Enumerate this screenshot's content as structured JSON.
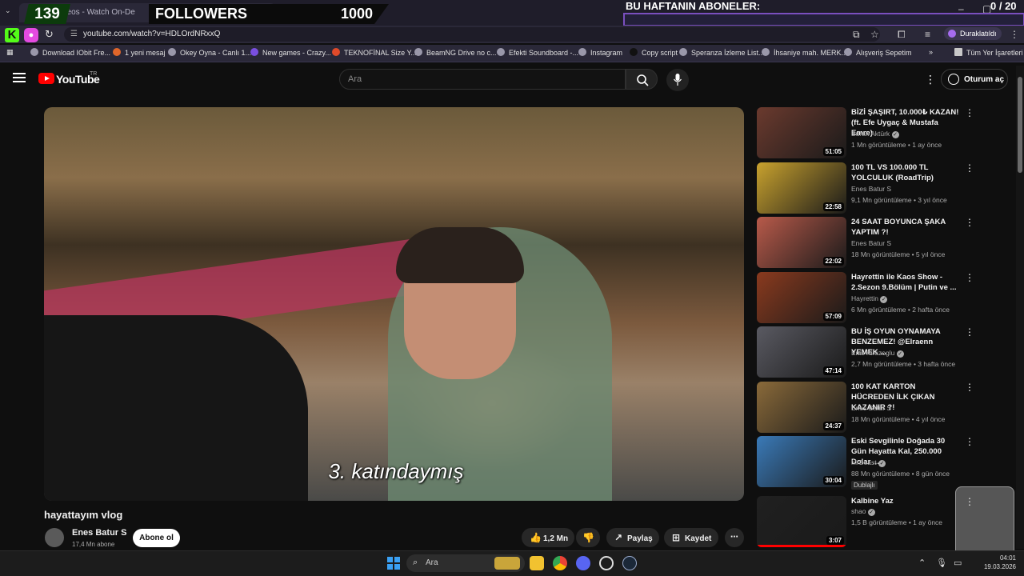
{
  "browser": {
    "tab_title": "deos - Watch On-De",
    "url": "youtube.com/watch?v=HDLOrdNRxxQ",
    "profile_label": "Duraklatıldı",
    "bookmarks": [
      "Download IObit Fre...",
      "1 yeni mesaj",
      "Okey Oyna - Canlı 1...",
      "New games - Crazy...",
      "TEKNOFİNAL Size Y...",
      "BeamNG Drive no c...",
      "Efekti Soundboard -...",
      "Instagram",
      "Copy script",
      "Speranza İzleme List...",
      "İhsaniye mah. MERK...",
      "Alışveriş Sepetim"
    ],
    "bookmarks_overflow": "»",
    "all_bookmarks": "Tüm Yer İşaretleri"
  },
  "overlay": {
    "follower_count": "139",
    "followers_label": "FOLLOWERS",
    "follower_goal": "1000",
    "subs_title": "BU HAFTANIN ABONELER:",
    "subs_count": "0 / 20"
  },
  "youtube": {
    "logo_text": "YouTube",
    "region": "TR",
    "search_placeholder": "Ara",
    "sign_in": "Oturum aç"
  },
  "video": {
    "subtitle": "3. katındaymış",
    "title": "hayattayım vlog",
    "channel": "Enes Batur S",
    "subscribers": "17,4 Mn abone",
    "subscribe_label": "Abone ol",
    "likes": "1,2 Mn",
    "share_label": "Paylaş",
    "save_label": "Kaydet"
  },
  "recommendations": [
    {
      "title": "BİZİ ŞAŞIRT, 10.000₺ KAZAN! (ft. Efe Uygaç & Mustafa Emre)",
      "channel": "Burak Aktürk",
      "verified": true,
      "meta": "1 Mn görüntüleme • 1 ay önce",
      "duration": "51:05",
      "color": "#6b3a2e"
    },
    {
      "title": "100 TL VS 100.000 TL YOLCULUK (RoadTrip)",
      "channel": "Enes Batur S",
      "verified": false,
      "meta": "9,1 Mn görüntüleme • 3 yıl önce",
      "duration": "22:58",
      "color": "#c9a22e"
    },
    {
      "title": "24 SAAT BOYUNCA ŞAKA YAPTIM ?!",
      "channel": "Enes Batur S",
      "verified": false,
      "meta": "18 Mn görüntüleme • 5 yıl önce",
      "duration": "22:02",
      "color": "#b85a4a"
    },
    {
      "title": "Hayrettin ile Kaos Show - 2.Sezon 9.Bölüm | Putin ve ...",
      "channel": "Hayrettin",
      "verified": true,
      "meta": "6 Mn görüntüleme • 2 hafta önce",
      "duration": "57:09",
      "color": "#8a3a1e"
    },
    {
      "title": "BU İŞ OYUN OYNAMAYA BENZEMEZ! @Elraenn YEMEK ...",
      "channel": "Enis Kirazoglu",
      "verified": true,
      "meta": "2,7 Mn görüntüleme • 3 hafta önce",
      "duration": "47:14",
      "color": "#5a5a62"
    },
    {
      "title": "100 KAT KARTON HÜCREDEN İLK ÇIKAN KAZANIR ?!",
      "channel": "Enes Batur S",
      "verified": false,
      "meta": "18 Mn görüntüleme • 4 yıl önce",
      "duration": "24:37",
      "color": "#8a6a3a"
    },
    {
      "title": "Eski Sevgilinle Doğada 30 Gün Hayatta Kal, 250.000 Dolar ...",
      "channel": "MrBeast",
      "verified": true,
      "meta": "88 Mn görüntüleme • 8 gün önce",
      "duration": "30:04",
      "color": "#3a7ab8",
      "badge": "Dublajlı"
    },
    {
      "title": "Kalbine Yaz",
      "channel": "shao",
      "verified": true,
      "meta": "1,5 B görüntüleme • 1 ay önce",
      "duration": "3:07",
      "color": "#202020"
    }
  ],
  "taskbar": {
    "search_label": "Ara",
    "time": "04:01",
    "date": "19.03.2026"
  }
}
